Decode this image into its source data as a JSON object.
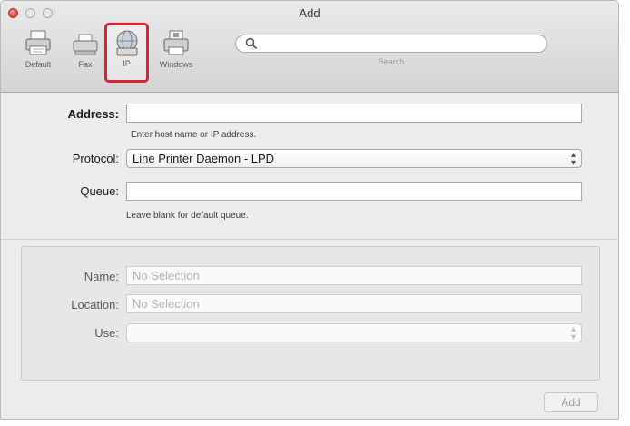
{
  "window": {
    "title": "Add"
  },
  "toolbar": {
    "tools": [
      {
        "label": "Default",
        "icon": "printer-icon"
      },
      {
        "label": "Fax",
        "icon": "fax-icon"
      },
      {
        "label": "IP",
        "icon": "globe-icon"
      },
      {
        "label": "Windows",
        "icon": "windows-printer-icon"
      }
    ],
    "selected_tool": "IP",
    "highlight_color": "#d9232e",
    "search": {
      "placeholder": "",
      "value": "",
      "caption": "Search"
    }
  },
  "form": {
    "address": {
      "label": "Address:",
      "value": "",
      "hint": "Enter host name or IP address."
    },
    "protocol": {
      "label": "Protocol:",
      "value": "Line Printer Daemon - LPD"
    },
    "queue": {
      "label": "Queue:",
      "value": "",
      "hint": "Leave blank for default queue."
    }
  },
  "details": {
    "name": {
      "label": "Name:",
      "value": "No Selection"
    },
    "location": {
      "label": "Location:",
      "value": "No Selection"
    },
    "use": {
      "label": "Use:",
      "value": ""
    }
  },
  "actions": {
    "add_label": "Add"
  }
}
